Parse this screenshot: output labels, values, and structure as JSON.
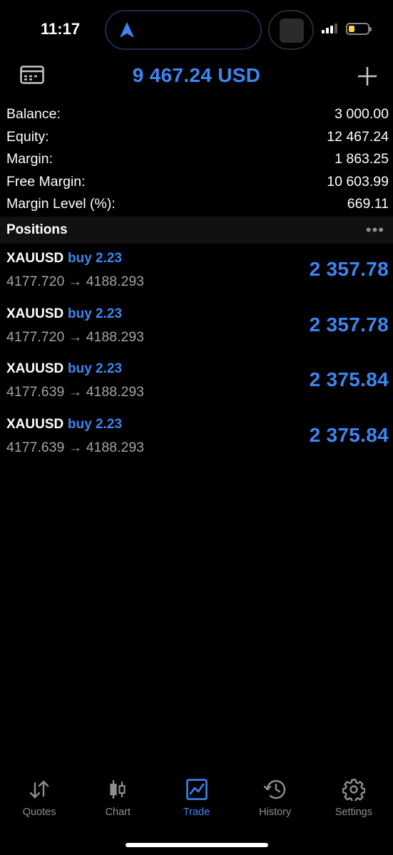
{
  "status_bar": {
    "time": "11:17",
    "accent": "#3d86f2"
  },
  "header": {
    "title": "9 467.24 USD",
    "left_icon": "card-icon",
    "right_icon": "plus-icon"
  },
  "summary": [
    {
      "label": "Balance:",
      "value": "3 000.00"
    },
    {
      "label": "Equity:",
      "value": "12 467.24"
    },
    {
      "label": "Margin:",
      "value": "1 863.25"
    },
    {
      "label": "Free Margin:",
      "value": "10 603.99"
    },
    {
      "label": "Margin Level (%):",
      "value": "669.11"
    }
  ],
  "positions_section": {
    "label": "Positions",
    "more": "•••"
  },
  "positions": [
    {
      "symbol": "XAUUSD",
      "direction": "buy 2.23",
      "open_price": "4177.720",
      "arrow": "→",
      "current_price": "4188.293",
      "profit": "2 357.78"
    },
    {
      "symbol": "XAUUSD",
      "direction": "buy 2.23",
      "open_price": "4177.720",
      "arrow": "→",
      "current_price": "4188.293",
      "profit": "2 357.78"
    },
    {
      "symbol": "XAUUSD",
      "direction": "buy 2.23",
      "open_price": "4177.639",
      "arrow": "→",
      "current_price": "4188.293",
      "profit": "2 375.84"
    },
    {
      "symbol": "XAUUSD",
      "direction": "buy 2.23",
      "open_price": "4177.639",
      "arrow": "→",
      "current_price": "4188.293",
      "profit": "2 375.84"
    }
  ],
  "tabs": [
    {
      "label": "Quotes",
      "icon": "quotes-icon",
      "active": false
    },
    {
      "label": "Chart",
      "icon": "chart-icon",
      "active": false
    },
    {
      "label": "Trade",
      "icon": "trade-icon",
      "active": true
    },
    {
      "label": "History",
      "icon": "history-icon",
      "active": false
    },
    {
      "label": "Settings",
      "icon": "settings-icon",
      "active": false
    }
  ]
}
